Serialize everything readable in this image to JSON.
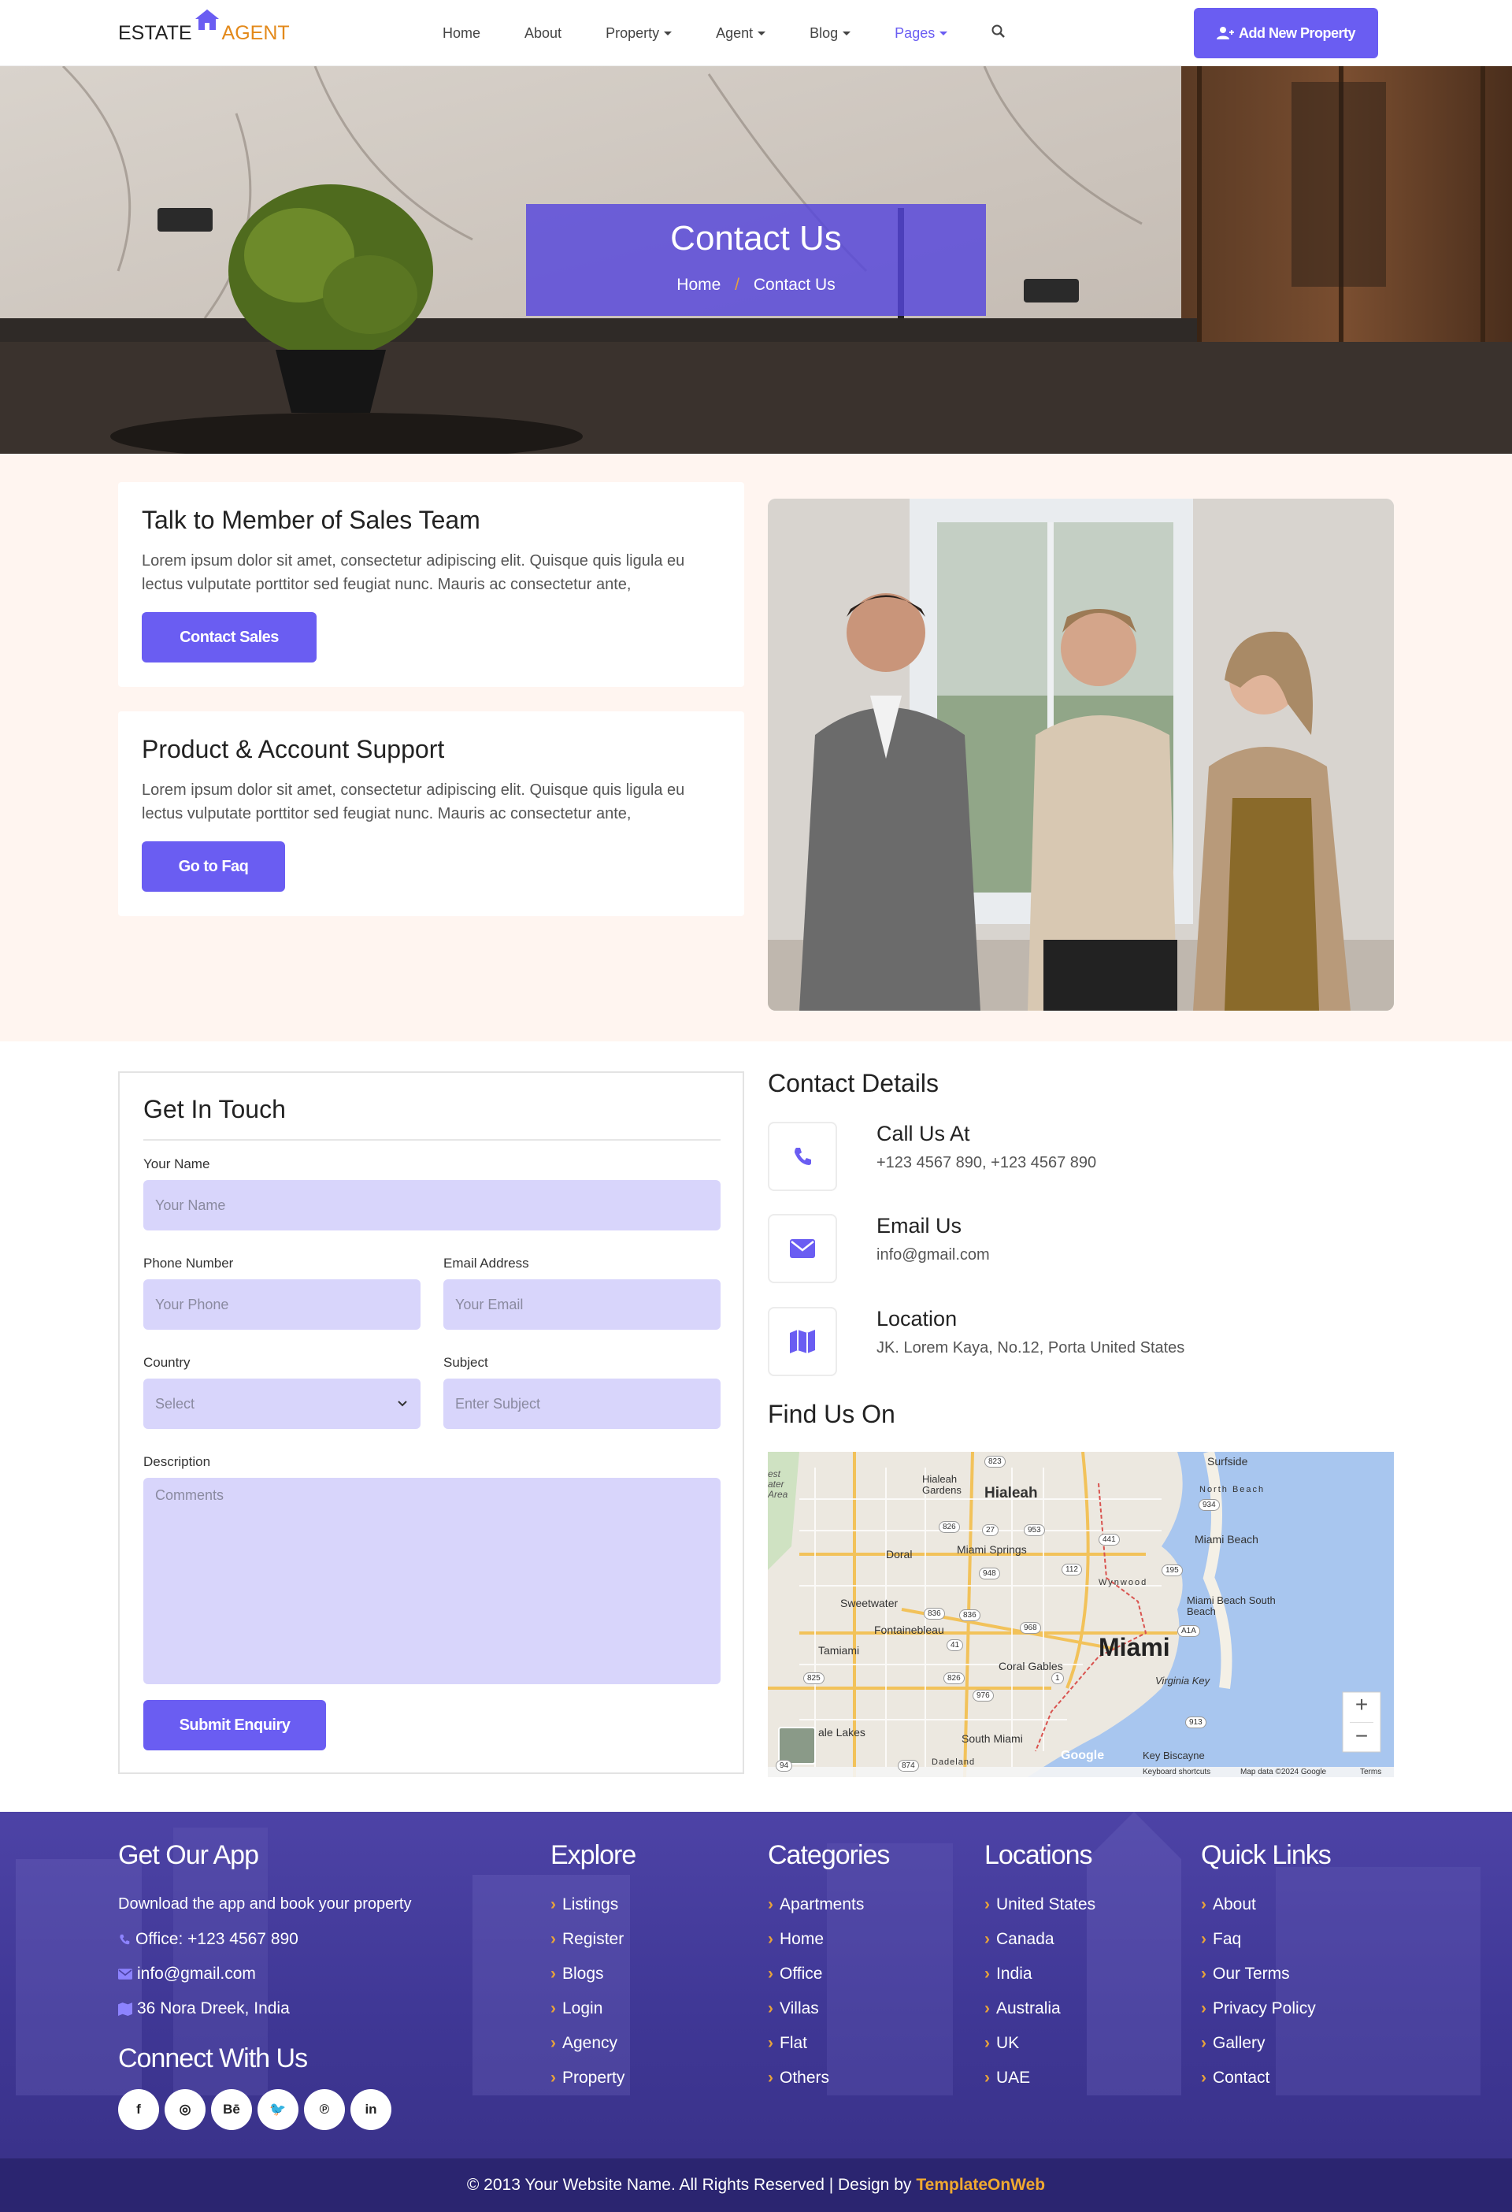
{
  "brand": {
    "part1": "ESTATE",
    "part2": "AGENT"
  },
  "nav": {
    "items": [
      {
        "label": "Home",
        "dropdown": false
      },
      {
        "label": "About",
        "dropdown": false
      },
      {
        "label": "Property",
        "dropdown": true
      },
      {
        "label": "Agent",
        "dropdown": true
      },
      {
        "label": "Blog",
        "dropdown": true
      },
      {
        "label": "Pages",
        "dropdown": true,
        "active": true
      }
    ],
    "search_icon": "search-icon",
    "add_button": "Add New Property"
  },
  "hero": {
    "title": "Contact Us",
    "breadcrumb": [
      "Home",
      "Contact Us"
    ],
    "separator": "/"
  },
  "support": {
    "cards": [
      {
        "title": "Talk to Member of Sales Team",
        "text": "Lorem ipsum dolor sit amet, consectetur adipiscing elit. Quisque quis ligula eu lectus vulputate porttitor sed feugiat nunc. Mauris ac consectetur ante,",
        "button": "Contact Sales"
      },
      {
        "title": "Product & Account Support",
        "text": "Lorem ipsum dolor sit amet, consectetur adipiscing elit. Quisque quis ligula eu lectus vulputate porttitor sed feugiat nunc. Mauris ac consectetur ante,",
        "button": "Go to Faq"
      }
    ]
  },
  "form": {
    "title": "Get In Touch",
    "name_label": "Your Name",
    "name_placeholder": "Your Name",
    "phone_label": "Phone Number",
    "phone_placeholder": "Your Phone",
    "email_label": "Email Address",
    "email_placeholder": "Your Email",
    "country_label": "Country",
    "country_value": "Select",
    "subject_label": "Subject",
    "subject_placeholder": "Enter Subject",
    "desc_label": "Description",
    "desc_placeholder": "Comments",
    "submit": "Submit Enquiry"
  },
  "contact": {
    "title": "Contact Details",
    "items": [
      {
        "title": "Call Us At",
        "value": "+123 4567 890, +123 4567 890",
        "icon": "phone-icon"
      },
      {
        "title": "Email Us",
        "value": "info@gmail.com",
        "icon": "envelope-icon"
      },
      {
        "title": "Location",
        "value": "JK. Lorem Kaya, No.12, Porta United States",
        "icon": "map-icon"
      }
    ],
    "find_title": "Find Us On"
  },
  "map": {
    "labels": [
      "Hialeah Gardens",
      "Hialeah",
      "Surfside",
      "North Beach",
      "Miami Beach",
      "Doral",
      "Miami Springs",
      "Wynwood",
      "Sweetwater",
      "Fontainebleau",
      "Miami Beach South Beach",
      "Tamiami",
      "Coral Gables",
      "Miami",
      "Virginia Key",
      "South Miami",
      "Key Biscayne",
      "Dadeland",
      "ale Lakes",
      "est ater Area"
    ],
    "route_badges": [
      "823",
      "826",
      "27",
      "953",
      "441",
      "934",
      "112",
      "948",
      "195",
      "836",
      "836",
      "968",
      "A1A",
      "41",
      "1",
      "826",
      "913",
      "874",
      "976",
      "825",
      "94"
    ],
    "attribution": [
      "Keyboard shortcuts",
      "Map data ©2024 Google",
      "Terms"
    ],
    "google": "Google",
    "zoom_in": "+",
    "zoom_out": "−"
  },
  "footer": {
    "app": {
      "title": "Get Our App",
      "text": "Download the app and book your property",
      "office": "Office: +123 4567 890",
      "email": "info@gmail.com",
      "address": "36 Nora Dreek, India"
    },
    "connect": {
      "title": "Connect With Us",
      "socials": [
        "f",
        "◎",
        "Bē",
        "🐦",
        "℗",
        "in"
      ],
      "social_names": [
        "facebook",
        "instagram",
        "behance",
        "twitter",
        "pinterest",
        "linkedin"
      ]
    },
    "explore": {
      "title": "Explore",
      "items": [
        "Listings",
        "Register",
        "Blogs",
        "Login",
        "Agency",
        "Property"
      ]
    },
    "categories": {
      "title": "Categories",
      "items": [
        "Apartments",
        "Home",
        "Office",
        "Villas",
        "Flat",
        "Others"
      ]
    },
    "locations": {
      "title": "Locations",
      "items": [
        "United States",
        "Canada",
        "India",
        "Australia",
        "UK",
        "UAE"
      ]
    },
    "quick": {
      "title": "Quick Links",
      "items": [
        "About",
        "Faq",
        "Our Terms",
        "Privacy Policy",
        "Gallery",
        "Contact"
      ]
    },
    "copyright": "© 2013 Your Website Name. All Rights Reserved | Design by",
    "designer": "TemplateOnWeb"
  },
  "colors": {
    "accent": "#6a5df2",
    "orange": "#e3891a",
    "footer": "#4d43a6",
    "field": "#d8d5fb"
  }
}
